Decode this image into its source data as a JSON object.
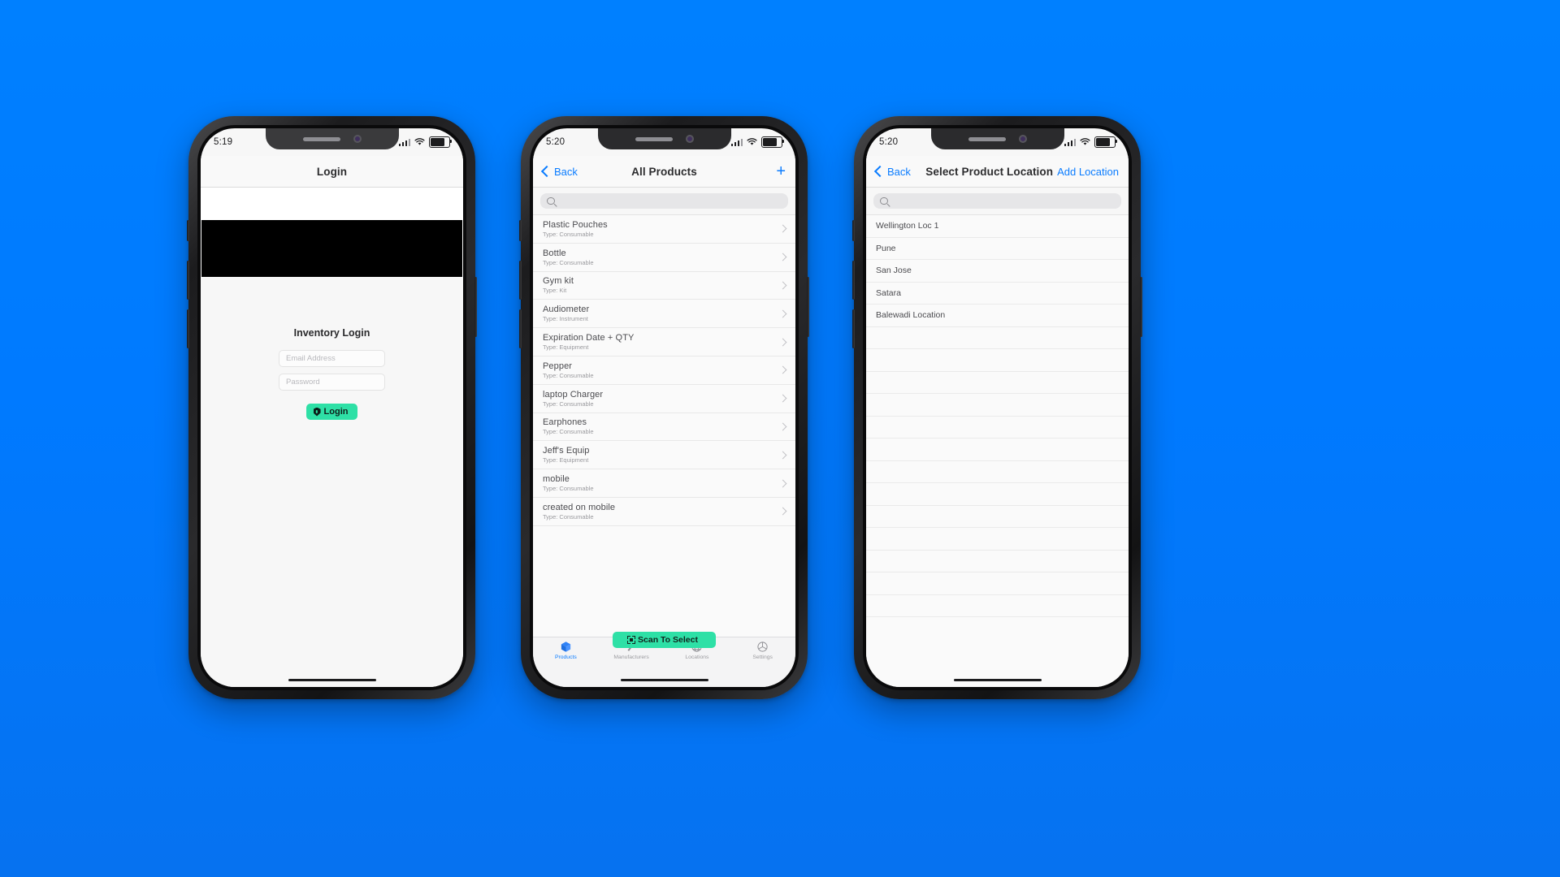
{
  "background_color": "#007AFF",
  "accent_blue": "#0A7CFF",
  "accent_green": "#2EE0A6",
  "phones": [
    {
      "id": "login-phone",
      "status_bar": {
        "time": "5:19"
      },
      "nav": {
        "title": "Login"
      },
      "login": {
        "heading": "Inventory Login",
        "email_placeholder": "Email Address",
        "email_value": "",
        "password_placeholder": "Password",
        "password_value": "",
        "button_label": "Login",
        "button_icon": "shield-lock-icon"
      }
    },
    {
      "id": "products-phone",
      "status_bar": {
        "time": "5:20"
      },
      "nav": {
        "back_label": "Back",
        "title": "All Products",
        "add_icon": "plus-icon"
      },
      "search": {
        "placeholder": "",
        "value": "",
        "icon": "search-icon"
      },
      "products": [
        {
          "name": "Plastic Pouches",
          "type": "Type: Consumable"
        },
        {
          "name": "Bottle",
          "type": "Type: Consumable"
        },
        {
          "name": "Gym kit",
          "type": "Type: Kit"
        },
        {
          "name": "Audiometer",
          "type": "Type: Instrument"
        },
        {
          "name": "Expiration Date + QTY",
          "type": "Type: Equipment"
        },
        {
          "name": "Pepper",
          "type": "Type: Consumable"
        },
        {
          "name": "laptop Charger",
          "type": "Type: Consumable"
        },
        {
          "name": "Earphones",
          "type": "Type: Consumable"
        },
        {
          "name": "Jeff's Equip",
          "type": "Type: Equipment"
        },
        {
          "name": "mobile",
          "type": "Type: Consumable"
        },
        {
          "name": "created on mobile",
          "type": "Type: Consumable"
        }
      ],
      "scan_button": {
        "label": "Scan To Select",
        "icon": "qr-scan-icon"
      },
      "tabs": [
        {
          "label": "Products",
          "icon": "box-icon",
          "active": true
        },
        {
          "label": "Manufacturers",
          "icon": "hammer-icon",
          "active": false
        },
        {
          "label": "Locations",
          "icon": "globe-icon",
          "active": false
        },
        {
          "label": "Settings",
          "icon": "gear-icon",
          "active": false
        }
      ]
    },
    {
      "id": "locations-phone",
      "status_bar": {
        "time": "5:20"
      },
      "nav": {
        "back_label": "Back",
        "title": "Select Product Location",
        "action_label": "Add Location"
      },
      "search": {
        "placeholder": "",
        "value": "",
        "icon": "search-icon"
      },
      "locations": [
        {
          "name": "Wellington Loc 1"
        },
        {
          "name": "Pune"
        },
        {
          "name": "San Jose"
        },
        {
          "name": "Satara"
        },
        {
          "name": "Balewadi Location"
        }
      ]
    }
  ]
}
